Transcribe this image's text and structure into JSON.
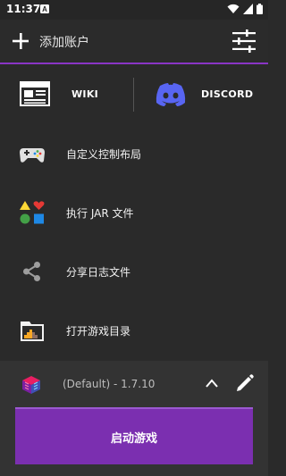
{
  "status_bar": {
    "time": "11:37",
    "notification_letter": "A"
  },
  "header": {
    "add_account_label": "添加账户"
  },
  "links": {
    "wiki_label": "WIKI",
    "discord_label": "DISCORD"
  },
  "menu": {
    "items": [
      {
        "label": "自定义控制布局",
        "icon": "gamepad-icon"
      },
      {
        "label": "执行 JAR 文件",
        "icon": "shapes-icon"
      },
      {
        "label": "分享日志文件",
        "icon": "share-icon"
      },
      {
        "label": "打开游戏目录",
        "icon": "folder-icon"
      }
    ]
  },
  "profile": {
    "version_label": "(Default) - 1.7.10"
  },
  "launch": {
    "label": "启动游戏"
  },
  "colors": {
    "accent": "#8a35c6",
    "launch_button": "#7b2fb0",
    "discord": "#5865f2"
  }
}
